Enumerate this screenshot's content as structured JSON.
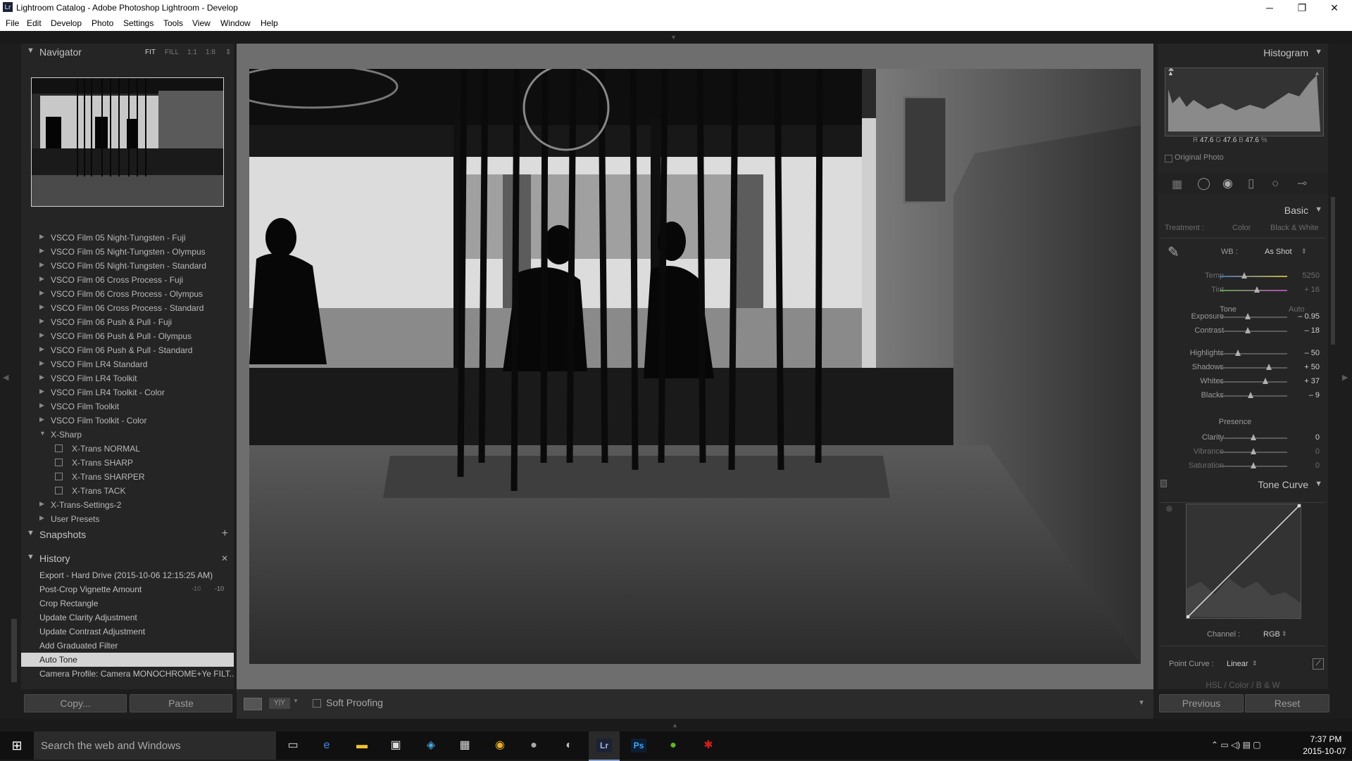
{
  "window": {
    "title": "Lightroom Catalog - Adobe Photoshop Lightroom - Develop",
    "app_icon": "Lr",
    "minimize": "─",
    "maximize": "❐",
    "close": "✕"
  },
  "menu": [
    "File",
    "Edit",
    "Develop",
    "Photo",
    "Settings",
    "Tools",
    "View",
    "Window",
    "Help"
  ],
  "navigator": {
    "title": "Navigator",
    "modes": [
      "FIT",
      "FILL",
      "1:1",
      "1:8"
    ]
  },
  "presets": [
    {
      "label": "VSCO Film 05 Night-Tungsten - Fuji",
      "type": "folder"
    },
    {
      "label": "VSCO Film 05 Night-Tungsten - Olympus",
      "type": "folder"
    },
    {
      "label": "VSCO Film 05 Night-Tungsten - Standard",
      "type": "folder"
    },
    {
      "label": "VSCO Film 06 Cross Process - Fuji",
      "type": "folder"
    },
    {
      "label": "VSCO Film 06 Cross Process - Olympus",
      "type": "folder"
    },
    {
      "label": "VSCO Film 06 Cross Process - Standard",
      "type": "folder"
    },
    {
      "label": "VSCO Film 06 Push & Pull - Fuji",
      "type": "folder"
    },
    {
      "label": "VSCO Film 06 Push & Pull - Olympus",
      "type": "folder"
    },
    {
      "label": "VSCO Film 06 Push & Pull - Standard",
      "type": "folder"
    },
    {
      "label": "VSCO Film LR4 Standard",
      "type": "folder"
    },
    {
      "label": "VSCO Film LR4 Toolkit",
      "type": "folder"
    },
    {
      "label": "VSCO Film LR4 Toolkit - Color",
      "type": "folder"
    },
    {
      "label": "VSCO Film Toolkit",
      "type": "folder"
    },
    {
      "label": "VSCO Film Toolkit - Color",
      "type": "folder"
    },
    {
      "label": "X-Sharp",
      "type": "open-folder"
    },
    {
      "label": "X-Trans NORMAL",
      "type": "item"
    },
    {
      "label": "X-Trans SHARP",
      "type": "item"
    },
    {
      "label": "X-Trans SHARPER",
      "type": "item"
    },
    {
      "label": "X-Trans TACK",
      "type": "item"
    },
    {
      "label": "X-Trans-Settings-2",
      "type": "folder"
    },
    {
      "label": "User Presets",
      "type": "folder"
    }
  ],
  "snapshots": {
    "title": "Snapshots",
    "add": "+"
  },
  "history": {
    "title": "History",
    "clear": "✕",
    "items": [
      {
        "label": "Export - Hard Drive (2015-10-06 12:15:25 AM)",
        "v1": "",
        "v2": ""
      },
      {
        "label": "Post-Crop Vignette Amount",
        "v1": "-10",
        "v2": "-10"
      },
      {
        "label": "Crop Rectangle",
        "v1": "",
        "v2": ""
      },
      {
        "label": "Update Clarity Adjustment",
        "v1": "",
        "v2": ""
      },
      {
        "label": "Update Contrast Adjustment",
        "v1": "",
        "v2": ""
      },
      {
        "label": "Add Graduated Filter",
        "v1": "",
        "v2": ""
      },
      {
        "label": "Auto Tone",
        "v1": "",
        "v2": "",
        "selected": true
      },
      {
        "label": "Camera Profile: Camera MONOCHROME+Ye FILT...",
        "v1": "",
        "v2": ""
      }
    ]
  },
  "left_buttons": {
    "copy": "Copy...",
    "paste": "Paste"
  },
  "toolbar": {
    "soft_proofing": "Soft Proofing",
    "view_compare": "Y|Y"
  },
  "histogram": {
    "title": "Histogram",
    "r_label": "R",
    "r": "47.6",
    "g_label": "G",
    "g": "47.6",
    "b_label": "B",
    "b": "47.6",
    "pct": "%",
    "original_photo": "Original Photo"
  },
  "basic": {
    "title": "Basic",
    "treatment_label": "Treatment :",
    "color": "Color",
    "bw": "Black & White",
    "wb_label": "WB :",
    "wb_value": "As Shot",
    "tone_label": "Tone",
    "auto": "Auto",
    "presence_label": "Presence",
    "sliders": [
      {
        "name": "Temp",
        "value": "5250",
        "pos": 0.36,
        "dim": true
      },
      {
        "name": "Tint",
        "value": "+ 16",
        "pos": 0.55,
        "dim": true
      },
      {
        "name": "Exposure",
        "value": "– 0.95",
        "pos": 0.42
      },
      {
        "name": "Contrast",
        "value": "– 18",
        "pos": 0.42
      },
      {
        "name": "Highlights",
        "value": "– 50",
        "pos": 0.27
      },
      {
        "name": "Shadows",
        "value": "+ 50",
        "pos": 0.73
      },
      {
        "name": "Whites",
        "value": "+ 37",
        "pos": 0.68
      },
      {
        "name": "Blacks",
        "value": "– 9",
        "pos": 0.46
      },
      {
        "name": "Clarity",
        "value": "0",
        "pos": 0.5
      },
      {
        "name": "Vibrance",
        "value": "0",
        "pos": 0.5,
        "dim": true
      },
      {
        "name": "Saturation",
        "value": "0",
        "pos": 0.5,
        "dim": true
      }
    ]
  },
  "tone_curve": {
    "title": "Tone Curve",
    "channel_label": "Channel :",
    "channel": "RGB",
    "point_curve_label": "Point Curve :",
    "point_curve": "Linear"
  },
  "hsl": {
    "title": "HSL / Color / B & W"
  },
  "right_buttons": {
    "previous": "Previous",
    "reset": "Reset"
  },
  "taskbar": {
    "search": "Search the web and Windows",
    "time": "7:37 PM",
    "date": "2015-10-07"
  }
}
